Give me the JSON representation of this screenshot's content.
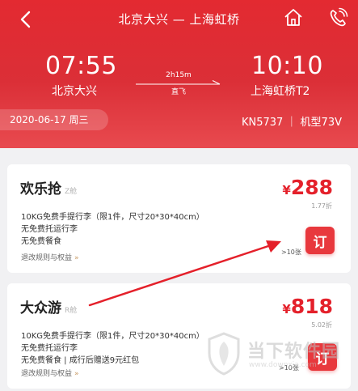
{
  "nav": {
    "title": "北京大兴 — 上海虹桥",
    "back_icon": "back-arrow-icon",
    "home_icon": "home-icon",
    "phone_icon": "phone-icon"
  },
  "flight": {
    "departure_time": "07:55",
    "departure_city": "北京大兴",
    "arrival_time": "10:10",
    "arrival_city": "上海虹桥T2",
    "duration": "2h15m",
    "type": "直飞",
    "date": "2020-06-17 周三",
    "info": "KN5737 ｜ 机型73V"
  },
  "fares": [
    {
      "name": "欢乐抢",
      "class": "Z舱",
      "currency": "¥",
      "price": "288",
      "discount": "1.77折",
      "perks": [
        "10KG免费手提行李（限1件，尺寸20*30*40cm）",
        "无免费托运行李",
        "无免费餐食"
      ],
      "rules": "退改规则与权益",
      "book_label": "订",
      "seats": ">10张"
    },
    {
      "name": "大众游",
      "class": "R舱",
      "currency": "¥",
      "price": "818",
      "discount": "5.02折",
      "perks": [
        "10KG免费手提行李（限1件，尺寸20*30*40cm）",
        "无免费托运行李",
        "无免费餐食 | 成行后赠送9元红包"
      ],
      "rules": "退改规则与权益",
      "book_label": "订",
      "seats": ">10张"
    }
  ],
  "watermark": {
    "text": "当下软件园",
    "url": "www.downxia.com"
  },
  "colors": {
    "brand_red": "#e32a31",
    "price_red": "#e4212b",
    "annotation_red": "#e4202a"
  }
}
